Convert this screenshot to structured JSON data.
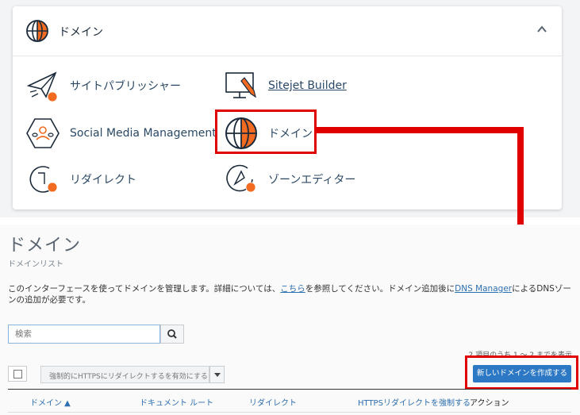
{
  "card": {
    "title": "ドメイン",
    "items": [
      {
        "label": "サイトパブリッシャー",
        "icon": "site-publisher-icon"
      },
      {
        "label": "Sitejet Builder",
        "icon": "sitejet-builder-icon"
      },
      {
        "label": "Social Media Management",
        "icon": "social-media-icon"
      },
      {
        "label": "ドメイン",
        "icon": "globe-icon"
      },
      {
        "label": "リダイレクト",
        "icon": "redirect-icon"
      },
      {
        "label": "ゾーンエディター",
        "icon": "zone-editor-icon"
      }
    ]
  },
  "page": {
    "title": "ドメイン",
    "subtitle": "ドメインリスト",
    "desc_before": "このインターフェースを使ってドメインを管理します。詳細については、",
    "desc_link1": "こちら",
    "desc_mid": "を参照してください。ドメイン追加後に",
    "desc_link2": "DNS Manager",
    "desc_after": "によるDNSゾーンの追加が必要です。",
    "search_placeholder": "検索",
    "count_text": "2 項目のうち 1 ～ 2 までを表示",
    "bulk_action": "強制的にHTTPSにリダイレクトするを有効にする",
    "create_button": "新しいドメインを作成する",
    "columns": [
      "ドメイン ▲",
      "ドキュメント ルート",
      "リダイレクト",
      "HTTPSリダイレクトを強制する",
      "アクション"
    ]
  },
  "colors": {
    "accent": "#e00000",
    "primary_button": "#2d78c4",
    "link": "#2d6fb0",
    "icon_orange": "#f26b21"
  }
}
